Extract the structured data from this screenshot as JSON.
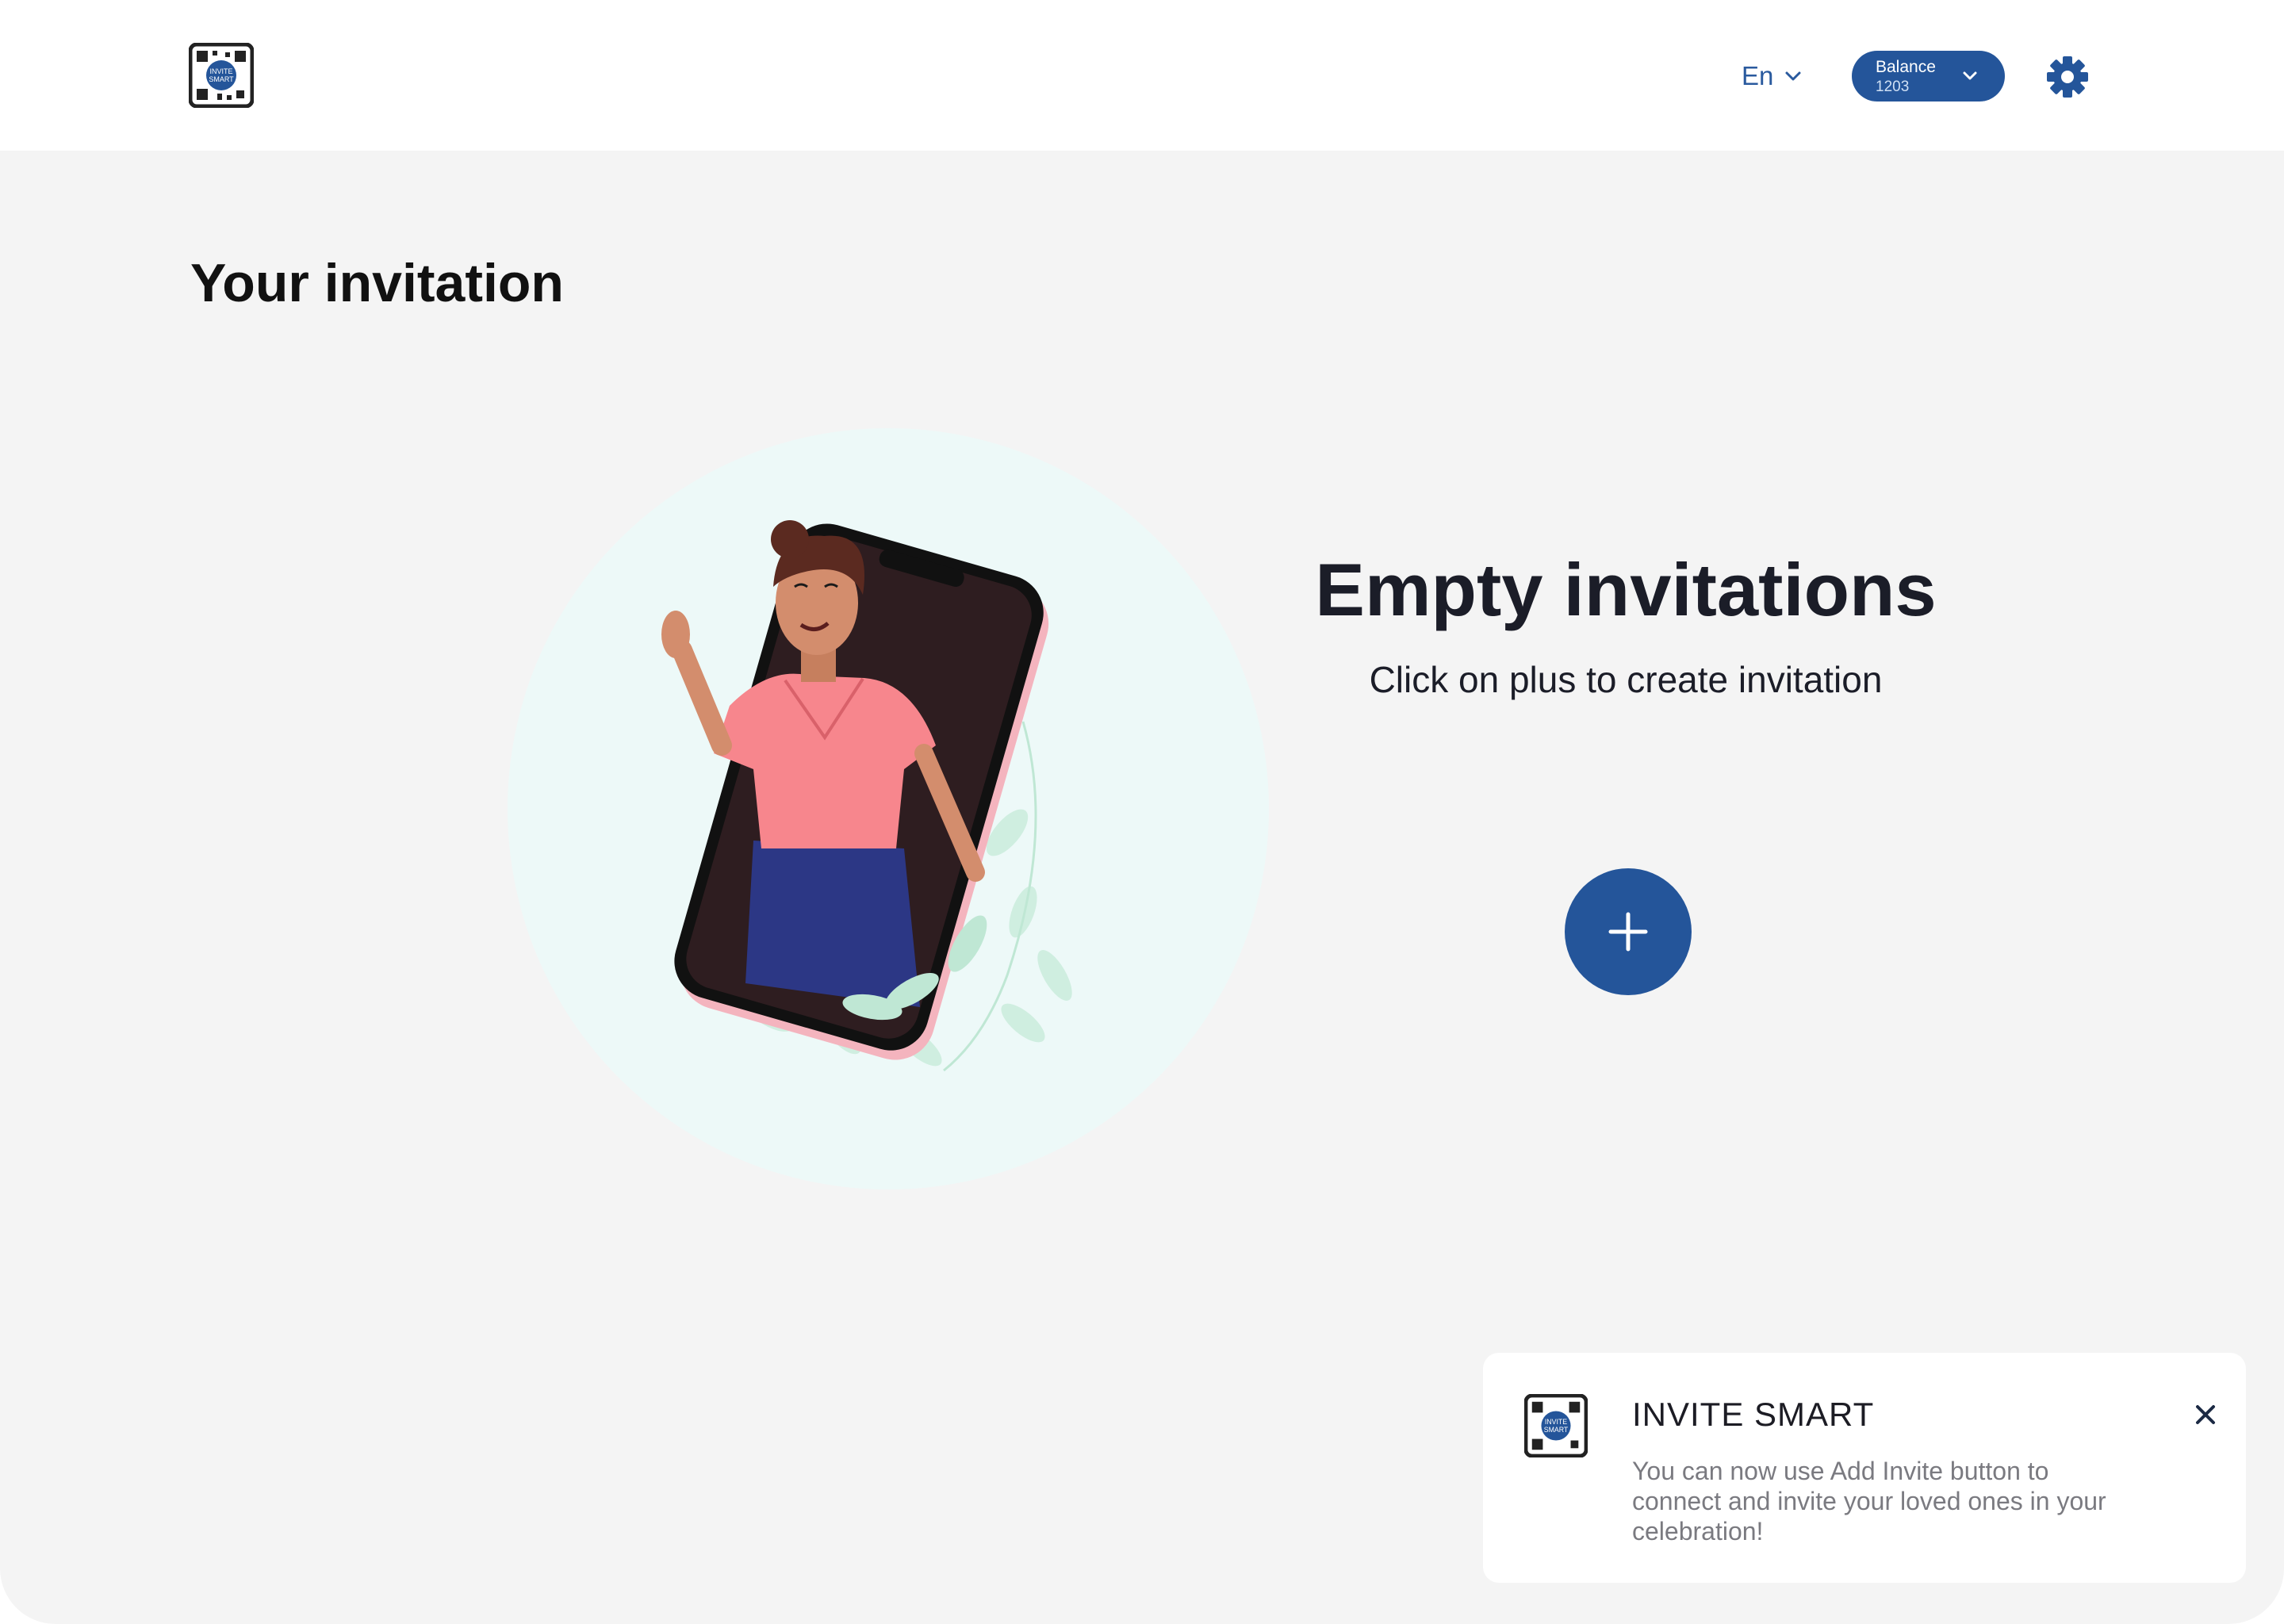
{
  "brand": {
    "logo_text_line1": "INVITE",
    "logo_text_line2": "SMART"
  },
  "header": {
    "language_label": "En",
    "balance_label": "Balance",
    "balance_value": "1203"
  },
  "main": {
    "title": "Your invitation",
    "empty_state_title": "Empty invitations",
    "empty_state_subtitle": "Click on plus to create invitation",
    "add_button_icon": "plus-icon"
  },
  "toast": {
    "title": "INVITE SMART",
    "message": "You can now use Add Invite button to connect and invite your loved ones in your celebration!"
  },
  "colors": {
    "primary": "#24559a",
    "background": "#f4f4f4",
    "illustration_circle": "#edf9f8",
    "text_dark": "#1b1d28"
  }
}
